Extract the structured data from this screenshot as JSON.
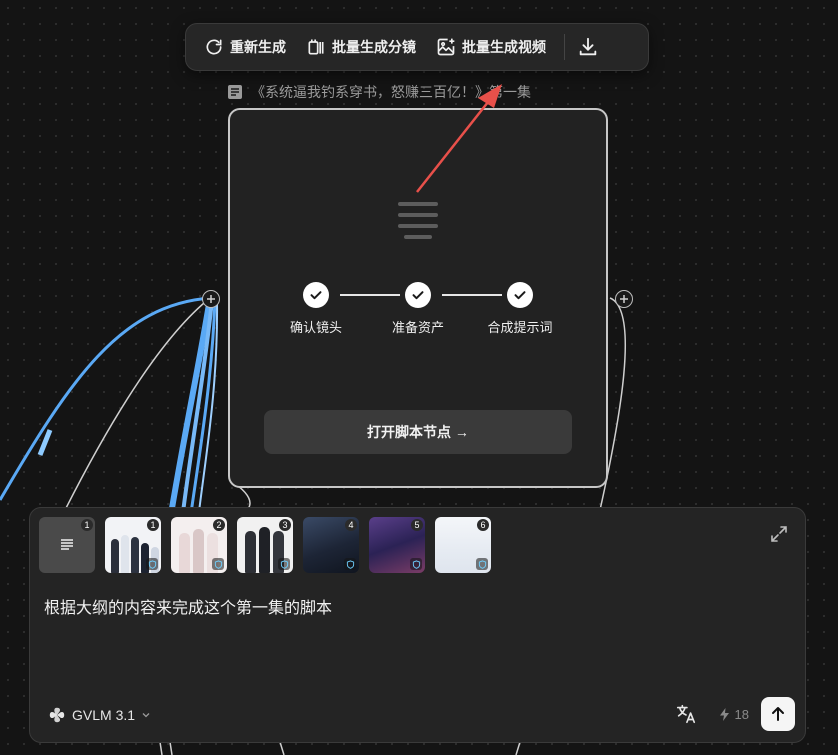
{
  "toolbar": {
    "regenerate_label": "重新生成",
    "batch_storyboard_label": "批量生成分镜",
    "batch_video_label": "批量生成视频",
    "download_icon": "download-icon"
  },
  "node": {
    "title": "《系统逼我钓系穿书，怒赚三百亿！》第一集",
    "steps": [
      {
        "label": "确认镜头",
        "done": true
      },
      {
        "label": "准备资产",
        "done": true
      },
      {
        "label": "合成提示词",
        "done": true
      }
    ],
    "open_button": "打开脚本节点 →"
  },
  "panel": {
    "assets": [
      {
        "type": "document",
        "num": "1"
      },
      {
        "type": "image",
        "num": "1"
      },
      {
        "type": "image",
        "num": "2"
      },
      {
        "type": "image",
        "num": "3"
      },
      {
        "type": "image",
        "num": "4"
      },
      {
        "type": "image",
        "num": "5"
      },
      {
        "type": "image",
        "num": "6"
      }
    ],
    "prompt": "根据大纲的内容来完成这个第一集的脚本",
    "model": "GVLM 3.1",
    "credits": "18"
  },
  "colors": {
    "background": "#141414",
    "wire_blue": "#5aa9f5",
    "annotation_red": "#e8504a"
  }
}
